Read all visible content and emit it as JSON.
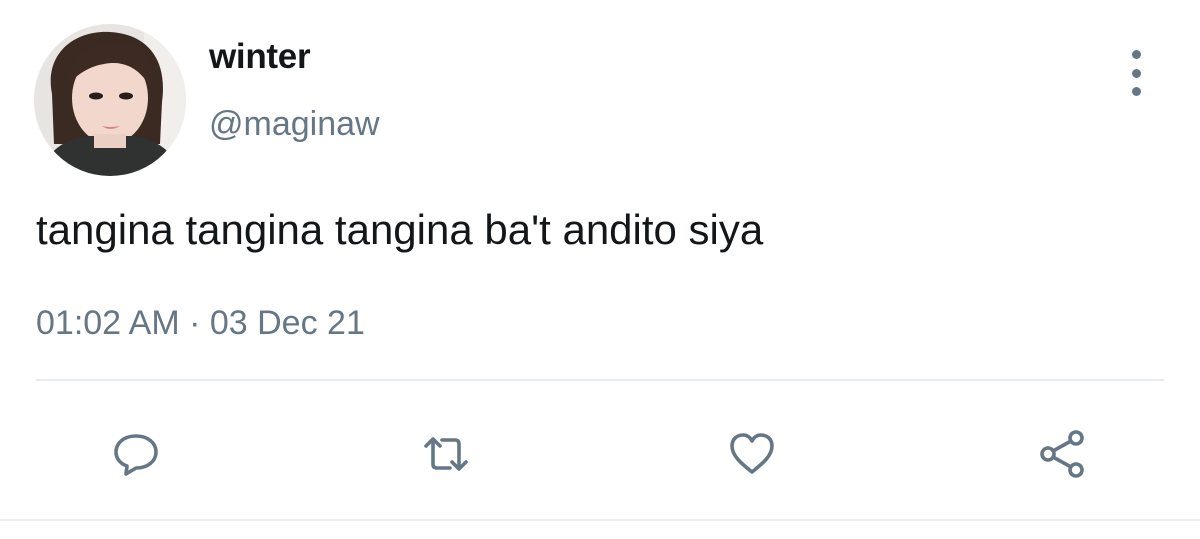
{
  "user": {
    "display_name": "winter",
    "handle": "@maginaw",
    "avatar_icon": "profile-photo"
  },
  "tweet": {
    "text": "tangina tangina tangina ba't andito siya",
    "timestamp": "01:02 AM · 03 Dec 21"
  },
  "actions": {
    "reply_icon": "comment-icon",
    "retweet_icon": "retweet-icon",
    "like_icon": "heart-icon",
    "share_icon": "share-icon"
  },
  "colors": {
    "primary_text": "#14171a",
    "secondary_text": "#657786",
    "divider": "#e6ecf0"
  }
}
